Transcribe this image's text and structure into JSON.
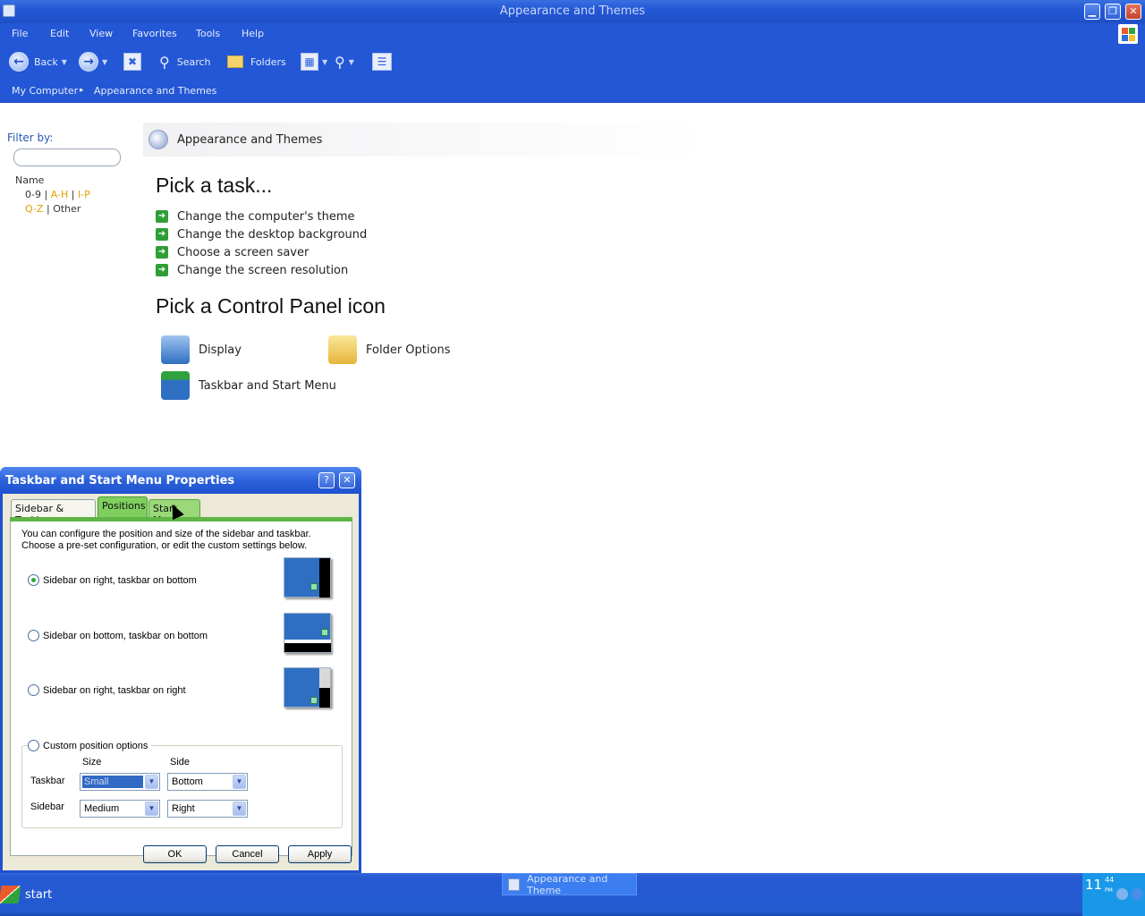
{
  "window": {
    "title": "Appearance and Themes",
    "minimize": "▁",
    "maximize": "❐",
    "close": "✕"
  },
  "menu": [
    "File",
    "Edit",
    "View",
    "Favorites",
    "Tools",
    "Help"
  ],
  "toolbar": {
    "back": "Back",
    "search": "Search",
    "folders": "Folders"
  },
  "address": {
    "root": "My Computer",
    "separator": "▸",
    "current": "Appearance and Themes"
  },
  "filter": {
    "label": "Filter by:",
    "input_value": "",
    "name_label": "Name",
    "row1": {
      "a": "0-9",
      "sep1": "|",
      "b": "A-H",
      "sep2": "|",
      "c": "I-P"
    },
    "row2": {
      "a": "Q-Z",
      "sep1": "|",
      "b": "Other"
    }
  },
  "category": {
    "title": "Appearance and Themes"
  },
  "tasks": {
    "heading": "Pick a task...",
    "items": [
      "Change the computer's theme",
      "Change the desktop background",
      "Choose a screen saver",
      "Change the screen resolution"
    ]
  },
  "icons": {
    "heading": "Pick a Control Panel icon",
    "items": [
      "Display",
      "Folder Options",
      "Taskbar and Start Menu"
    ]
  },
  "dialog": {
    "title": "Taskbar and Start Menu Properties",
    "help": "?",
    "close": "✕",
    "tabs": [
      "Sidebar & Taskbar",
      "Positions",
      "Start Menu"
    ],
    "active_tab": "Positions",
    "description": "You can configure the position and size of the sidebar and taskbar. Choose a pre-set configuration, or edit the custom settings below.",
    "options": [
      {
        "label": "Sidebar on right, taskbar on bottom",
        "selected": true
      },
      {
        "label": "Sidebar on bottom, taskbar on bottom",
        "selected": false
      },
      {
        "label": "Sidebar on right, taskbar on right",
        "selected": false
      },
      {
        "label": "Custom position options",
        "selected": false
      }
    ],
    "custom": {
      "size_header": "Size",
      "side_header": "Side",
      "taskbar_label": "Taskbar",
      "sidebar_label": "Sidebar",
      "taskbar_size": "Small",
      "taskbar_side": "Bottom",
      "sidebar_size": "Medium",
      "sidebar_side": "Right"
    },
    "buttons": {
      "ok": "OK",
      "cancel": "Cancel",
      "apply": "Apply"
    }
  },
  "taskbar": {
    "start": "start",
    "active_task": "Appearance and Theme",
    "clock": "11",
    "clock_min": "44",
    "clock_ampm": "PM"
  },
  "colors": {
    "xp_blue": "#2457d6",
    "task_arrow": "#2f9e37",
    "tab_active": "#7fcf5e",
    "tray": "#1a98e8"
  }
}
